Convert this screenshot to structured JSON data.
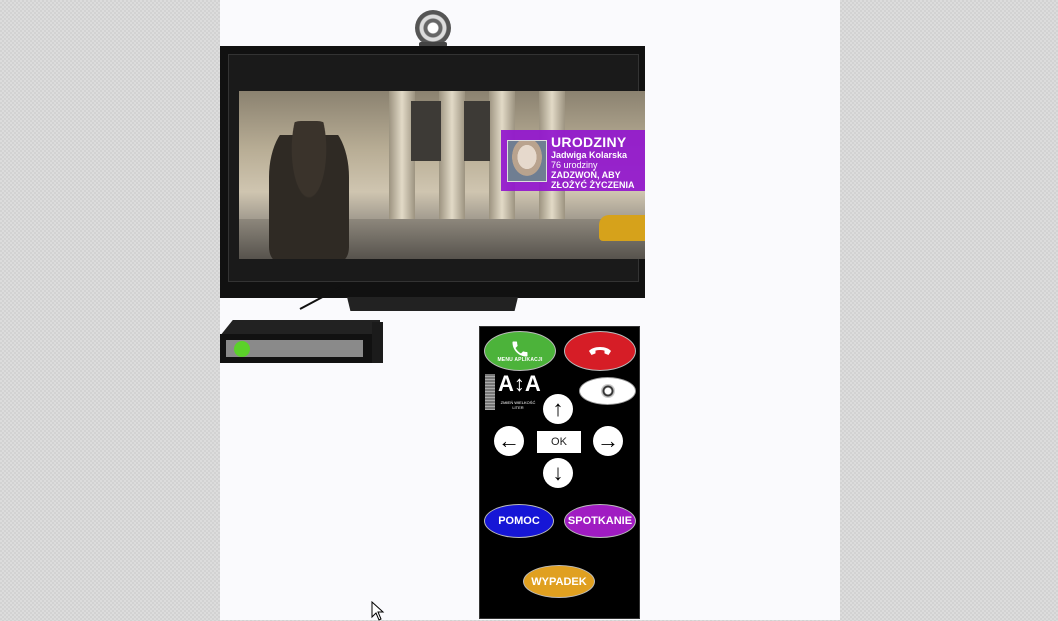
{
  "notification": {
    "title": "URODZINY",
    "name": "Jadwiga Kolarska",
    "age": "76 urodziny",
    "cta_line1": "ZADZWOŃ, ABY",
    "cta_line2": "ZŁOŻYĆ ŻYCZENIA"
  },
  "remote": {
    "call_label": "MENU APLIKACJI",
    "font_icon": "A↕A",
    "font_label": "ZMIEŃ WIELKOŚĆ LITER",
    "ok_label": "OK",
    "help_label": "POMOC",
    "meeting_label": "SPOTKANIE",
    "accident_label": "WYPADEK",
    "icons": {
      "call": "phone-icon",
      "hangup": "hangup-icon",
      "camera": "camera-icon",
      "up": "arrow-up-icon",
      "down": "arrow-down-icon",
      "left": "arrow-left-icon",
      "right": "arrow-right-icon"
    }
  },
  "colors": {
    "notification_bg": "#9316ce",
    "call_green": "#4cb33a",
    "hangup_red": "#d61d26",
    "help_blue": "#1616d6",
    "meeting_purple": "#a01cc2",
    "accident_orange": "#e0a020",
    "status_led": "#5bd12a"
  }
}
